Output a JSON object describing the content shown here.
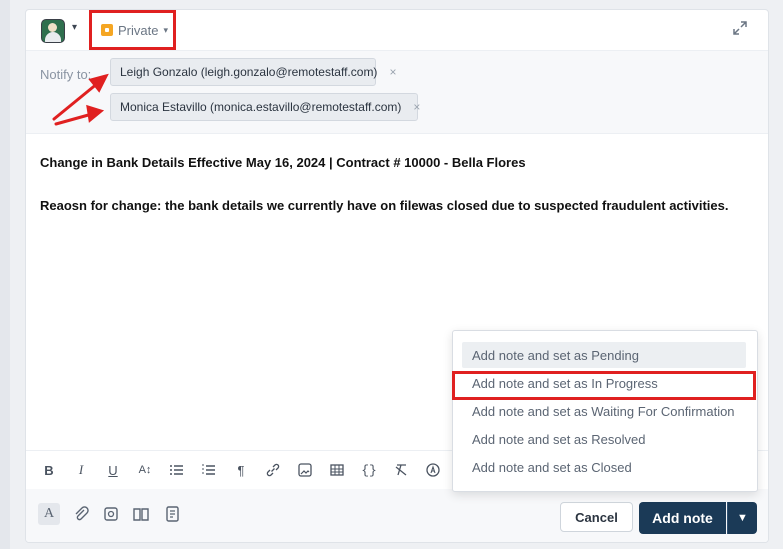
{
  "header": {
    "visibility_label": "Private"
  },
  "notify": {
    "label": "Notify to:",
    "recipients": [
      {
        "text": "Leigh Gonzalo (leigh.gonzalo@remotestaff.com)",
        "remove": "×"
      },
      {
        "text": "Monica Estavillo (monica.estavillo@remotestaff.com)",
        "remove": "×"
      }
    ]
  },
  "note": {
    "line1": "Change in Bank Details Effective May 16, 2024 | Contract # 10000 - Bella Flores",
    "line2": "Reaosn for change: the bank details we currently have on filewas closed due to suspected fraudulent activities."
  },
  "formatting": {
    "bold": "B",
    "italic": "I",
    "underline": "U",
    "font_size": "A↕",
    "paragraph": "¶",
    "code_block": "{}"
  },
  "footer": {
    "cancel_label": "Cancel",
    "add_note_label": "Add note"
  },
  "dropdown": {
    "items": [
      "Add note and set as Pending",
      "Add note and set as In Progress",
      "Add note and set as Waiting For Confirmation",
      "Add note and set as Resolved",
      "Add note and set as Closed"
    ]
  },
  "colors": {
    "primary_button": "#1b3a57",
    "annotation_red": "#e02020",
    "lock_orange": "#f5a623"
  }
}
